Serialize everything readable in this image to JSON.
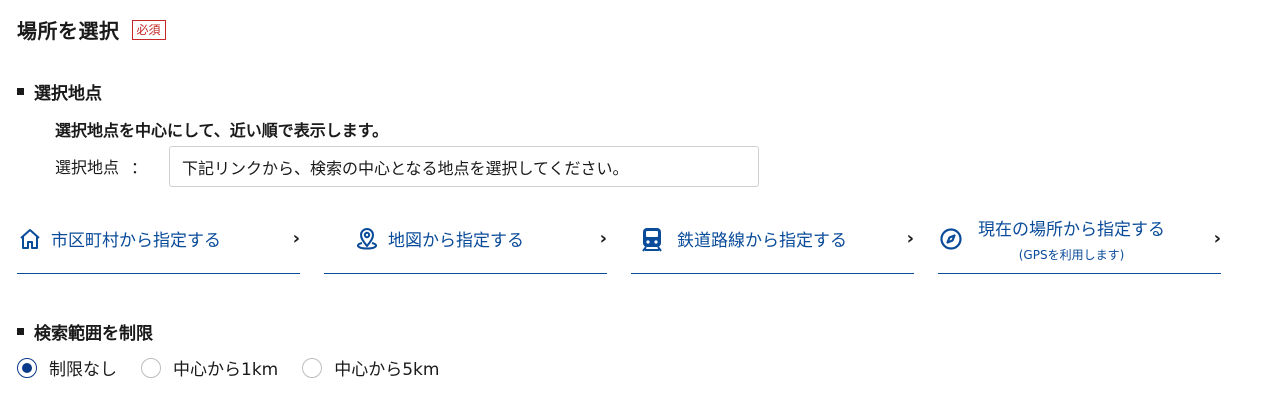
{
  "header": {
    "title": "場所を選択",
    "required_badge": "必須"
  },
  "selection": {
    "heading": "選択地点",
    "description": "選択地点を中心にして、近い順で表示します。",
    "location_label": "選択地点",
    "location_colon": "：",
    "location_value": "下記リンクから、検索の中心となる地点を選択してください。"
  },
  "links": [
    {
      "label": "市区町村から指定する",
      "icon": "home-icon"
    },
    {
      "label": "地図から指定する",
      "icon": "map-pin-icon"
    },
    {
      "label": "鉄道路線から指定する",
      "icon": "train-icon"
    },
    {
      "label": "現在の場所から指定する",
      "sublabel": "(GPSを利用します)",
      "icon": "compass-icon"
    }
  ],
  "chevron": "›",
  "range": {
    "heading": "検索範囲を制限",
    "options": [
      "制限なし",
      "中心から1km",
      "中心から5km"
    ],
    "selected_index": 0
  },
  "colors": {
    "accent": "#0a4b9a",
    "required": "#c62828",
    "radio_selected": "#0a3a8a"
  }
}
